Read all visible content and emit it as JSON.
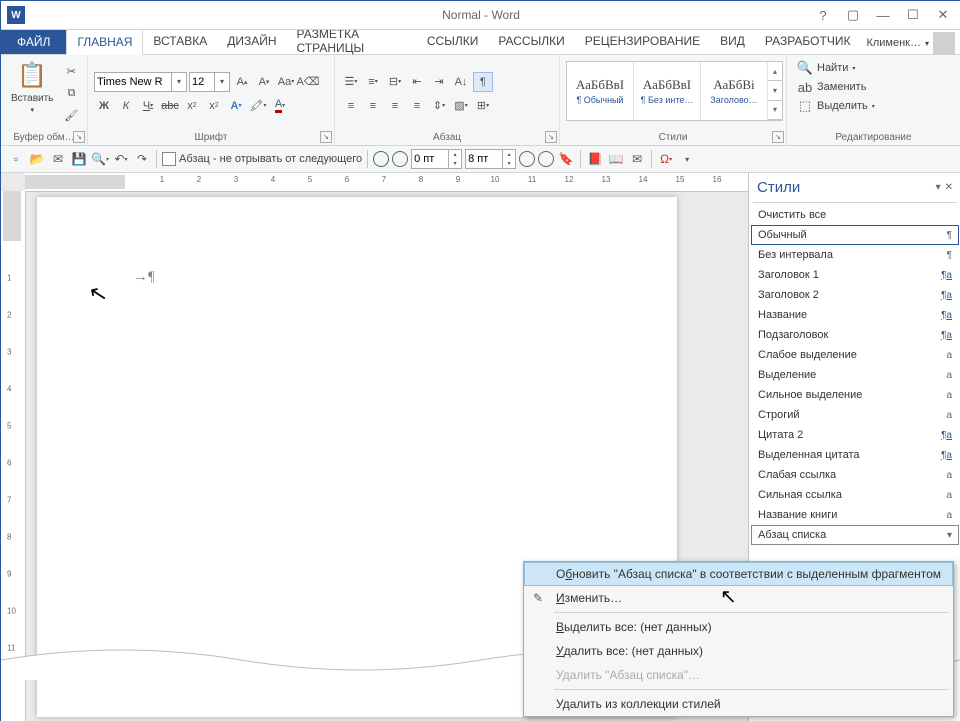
{
  "titlebar": {
    "title": "Normal - Word",
    "user": "Клименк…"
  },
  "tabs": {
    "file": "ФАЙЛ",
    "items": [
      "ГЛАВНАЯ",
      "ВСТАВКА",
      "ДИЗАЙН",
      "РАЗМЕТКА СТРАНИЦЫ",
      "ССЫЛКИ",
      "РАССЫЛКИ",
      "РЕЦЕНЗИРОВАНИЕ",
      "ВИД",
      "РАЗРАБОТЧИК"
    ],
    "active": 0
  },
  "ribbon": {
    "clipboard": {
      "label": "Буфер обм…",
      "paste": "Вставить"
    },
    "font": {
      "label": "Шрифт",
      "name": "Times New R",
      "size": "12"
    },
    "paragraph": {
      "label": "Абзац"
    },
    "styles": {
      "label": "Стили",
      "items": [
        {
          "preview": "АаБбВвІ",
          "name": "¶ Обычный"
        },
        {
          "preview": "АаБбВвІ",
          "name": "¶ Без инте…"
        },
        {
          "preview": "АаБбВі",
          "name": "Заголово…"
        }
      ]
    },
    "editing": {
      "label": "Редактирование",
      "find": "Найти",
      "replace": "Заменить",
      "select": "Выделить"
    }
  },
  "qat": {
    "checkbox_label": "Абзац - не отрывать от следующего",
    "spin1": "0 пт",
    "spin2": "8 пт"
  },
  "stylesPane": {
    "title": "Стили",
    "clear": "Очистить все",
    "items": [
      {
        "name": "Обычный",
        "glyph": "¶",
        "selected": true
      },
      {
        "name": "Без интервала",
        "glyph": "¶"
      },
      {
        "name": "Заголовок 1",
        "glyph": "¶a",
        "u": true
      },
      {
        "name": "Заголовок 2",
        "glyph": "¶a",
        "u": true
      },
      {
        "name": "Название",
        "glyph": "¶a",
        "u": true
      },
      {
        "name": "Подзаголовок",
        "glyph": "¶a",
        "u": true
      },
      {
        "name": "Слабое выделение",
        "glyph": "a"
      },
      {
        "name": "Выделение",
        "glyph": "a"
      },
      {
        "name": "Сильное выделение",
        "glyph": "a"
      },
      {
        "name": "Строгий",
        "glyph": "a"
      },
      {
        "name": "Цитата 2",
        "glyph": "¶a",
        "u": true
      },
      {
        "name": "Выделенная цитата",
        "glyph": "¶a",
        "u": true
      },
      {
        "name": "Слабая ссылка",
        "glyph": "a"
      },
      {
        "name": "Сильная ссылка",
        "glyph": "a"
      },
      {
        "name": "Название книги",
        "glyph": "a"
      },
      {
        "name": "Абзац списка",
        "glyph": "",
        "outlined": true,
        "dd": true
      }
    ]
  },
  "contextMenu": {
    "items": [
      {
        "text": "Обновить \"Абзац списка\" в соответствии с выделенным фрагментом",
        "hover": true,
        "u": 1
      },
      {
        "text": "Изменить…",
        "icon": "✎",
        "u": 0
      },
      {
        "sep": true
      },
      {
        "text": "Выделить все: (нет данных)",
        "u": 0
      },
      {
        "text": "Удалить все: (нет данных)",
        "u": 0
      },
      {
        "text": "Удалить \"Абзац списка\"…",
        "disabled": true
      },
      {
        "sep": true
      },
      {
        "text": "Удалить из коллекции стилей"
      }
    ]
  },
  "doc": {
    "tab_char": "→",
    "pilcrow": "¶"
  }
}
